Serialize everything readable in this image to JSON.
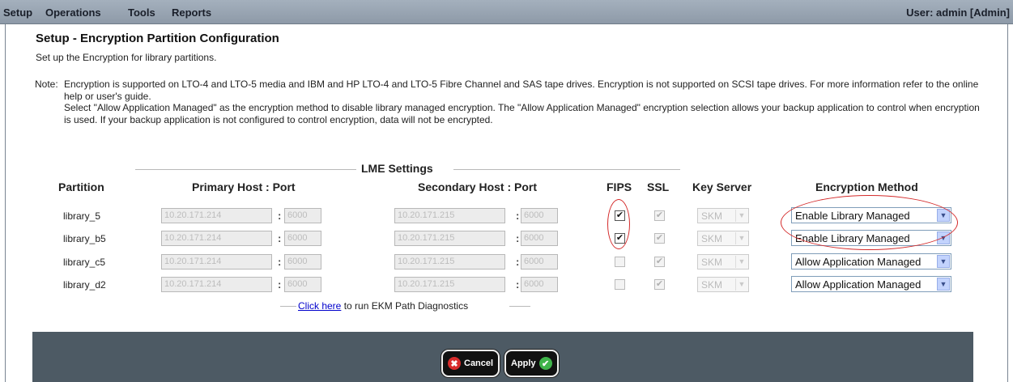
{
  "menu": {
    "items": [
      "Setup",
      "Operations",
      "Tools",
      "Reports"
    ],
    "user": "User: admin [Admin]"
  },
  "page": {
    "title": "Setup - Encryption Partition Configuration",
    "subtitle": "Set up the Encryption for library partitions.",
    "note_label": "Note:",
    "note_line1": "Encryption is supported on LTO-4 and LTO-5 media and IBM and HP LTO-4 and LTO-5 Fibre Channel and SAS tape drives. Encryption is not supported on SCSI tape drives. For more information refer to the online help or user's guide.",
    "note_line2": "Select \"Allow Application Managed\" as the encryption method to disable library managed encryption. The \"Allow Application Managed\" encryption selection allows your backup application to control when encryption is used. If your backup application is not configured to control encryption, data will not be encrypted."
  },
  "lme": {
    "title": "LME Settings",
    "headers": {
      "partition": "Partition",
      "primary": "Primary Host : Port",
      "secondary": "Secondary Host : Port",
      "fips": "FIPS",
      "ssl": "SSL",
      "key_server": "Key Server",
      "enc_method": "Encryption Method"
    },
    "rows": [
      {
        "partition": "library_5",
        "primary_host": "10.20.171.214",
        "primary_port": "6000",
        "secondary_host": "10.20.171.215",
        "secondary_port": "6000",
        "fips": "✔",
        "ssl": "✔",
        "key_server": "SKM",
        "enc_method": "Enable Library Managed"
      },
      {
        "partition": "library_b5",
        "primary_host": "10.20.171.214",
        "primary_port": "6000",
        "secondary_host": "10.20.171.215",
        "secondary_port": "6000",
        "fips": "✔",
        "ssl": "✔",
        "key_server": "SKM",
        "enc_method": "Enable Library Managed"
      },
      {
        "partition": "library_c5",
        "primary_host": "10.20.171.214",
        "primary_port": "6000",
        "secondary_host": "10.20.171.215",
        "secondary_port": "6000",
        "fips": "",
        "ssl": "✔",
        "key_server": "SKM",
        "enc_method": "Allow Application Managed"
      },
      {
        "partition": "library_d2",
        "primary_host": "10.20.171.214",
        "primary_port": "6000",
        "secondary_host": "10.20.171.215",
        "secondary_port": "6000",
        "fips": "",
        "ssl": "✔",
        "key_server": "SKM",
        "enc_method": "Allow Application Managed"
      }
    ],
    "separator": ":",
    "dropdown_arrow": "▼"
  },
  "diagnostics": {
    "link_text": "Click here",
    "rest_text": " to run EKM Path Diagnostics"
  },
  "buttons": {
    "cancel_label": "Cancel",
    "cancel_icon": "✖",
    "apply_label": "Apply",
    "apply_icon": "✔"
  },
  "colors": {
    "menubar": "#9aa6b3",
    "footer": "#4d5a64",
    "highlight": "#d42a2a",
    "link": "#0000cc"
  }
}
